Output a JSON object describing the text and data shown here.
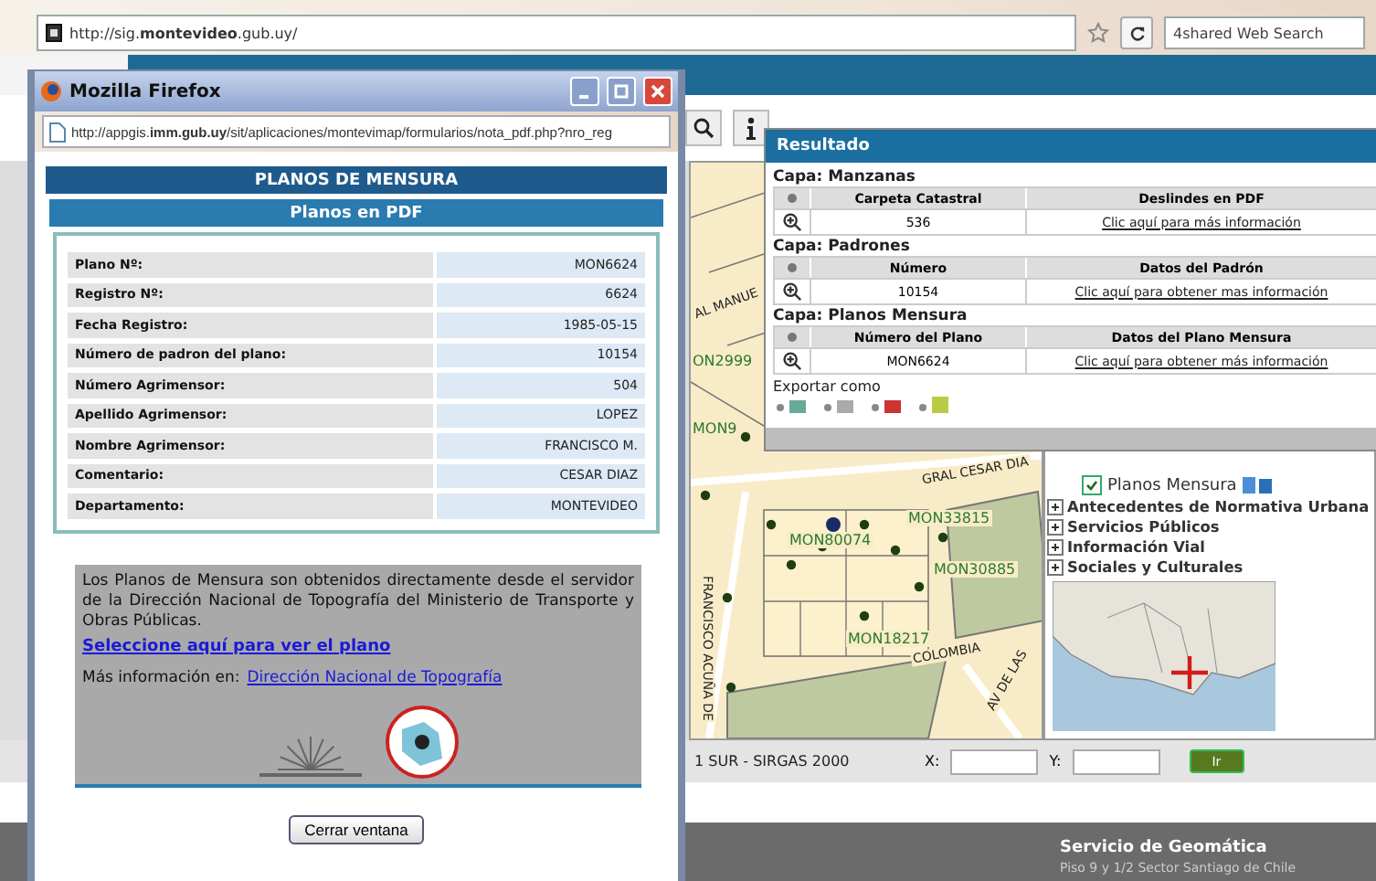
{
  "browser": {
    "url": "http://sig.**montevideo**.gub.uy/",
    "search_placeholder": "4shared Web Search"
  },
  "popup": {
    "title": "Mozilla Firefox",
    "url": "http://appgis.**imm.gub.uy**/sit/aplicaciones/montevimap/formularios/nota_pdf.php?nro_reg",
    "heading": "PLANOS DE MENSURA",
    "subheading": "Planos en PDF",
    "fields": [
      {
        "label": "Plano Nº:",
        "value": "MON6624"
      },
      {
        "label": "Registro Nº:",
        "value": "6624"
      },
      {
        "label": "Fecha Registro:",
        "value": "1985-05-15"
      },
      {
        "label": "Número de padron del plano:",
        "value": "10154"
      },
      {
        "label": "Número Agrimensor:",
        "value": "504"
      },
      {
        "label": "Apellido Agrimensor:",
        "value": "LOPEZ"
      },
      {
        "label": "Nombre Agrimensor:",
        "value": "FRANCISCO M."
      },
      {
        "label": "Comentario:",
        "value": "CESAR DIAZ"
      },
      {
        "label": "Departamento:",
        "value": "MONTEVIDEO"
      }
    ],
    "notice": "Los Planos de Mensura son obtenidos directamente desde el servidor de la Dirección Nacional de Topografía del Ministerio de Transporte y Obras Públicas.",
    "plan_link": "Seleccione aquí para ver el plano",
    "more_info_label": "Más información en:",
    "more_info_link": "Dirección Nacional de Topografía",
    "close_button": "Cerrar ventana"
  },
  "map": {
    "labels": [
      {
        "text": "AL MANUE"
      },
      {
        "text": "ON2999"
      },
      {
        "text": "MON9"
      },
      {
        "text": "GRAL CESAR DIA"
      },
      {
        "text": "MON80074"
      },
      {
        "text": "MON33815"
      },
      {
        "text": "MON30885"
      },
      {
        "text": "MON18217"
      },
      {
        "text": "COLOMBIA"
      },
      {
        "text": "FRANCISCO ACUÑA DE"
      },
      {
        "text": "AV DE LAS"
      }
    ]
  },
  "layers": {
    "checked_layer": {
      "label": "Planos Mensura",
      "checked": true
    },
    "groups": [
      {
        "label": "Antecedentes de Normativa Urbana",
        "expanded": false
      },
      {
        "label": "Servicios Públicos",
        "expanded": false
      },
      {
        "label": "Información Vial",
        "expanded": false
      },
      {
        "label": "Sociales y Culturales",
        "expanded": false
      }
    ]
  },
  "result": {
    "title": "Resultado",
    "layers": [
      {
        "name": "Capa: Manzanas",
        "columns": [
          "Carpeta Catastral",
          "Deslindes en PDF"
        ],
        "cells": [
          "536",
          "Clic aquí para más información"
        ]
      },
      {
        "name": "Capa: Padrones",
        "columns": [
          "Número",
          "Datos del Padrón"
        ],
        "cells": [
          "10154",
          "Clic aquí para obtener mas información"
        ]
      },
      {
        "name": "Capa: Planos Mensura",
        "columns": [
          "Número del Plano",
          "Datos del Plano Mensura"
        ],
        "cells": [
          "MON6624",
          "Clic aquí para obtener más información"
        ]
      }
    ],
    "export_label": "Exportar como"
  },
  "coordinates": {
    "projection": "1 SUR - SIRGAS 2000",
    "x_label": "X:",
    "y_label": "Y:",
    "go_button": "Ir"
  },
  "footer": {
    "title": "Servicio de Geomática",
    "address": "Piso 9 y 1/2 Sector Santiago de Chile"
  }
}
